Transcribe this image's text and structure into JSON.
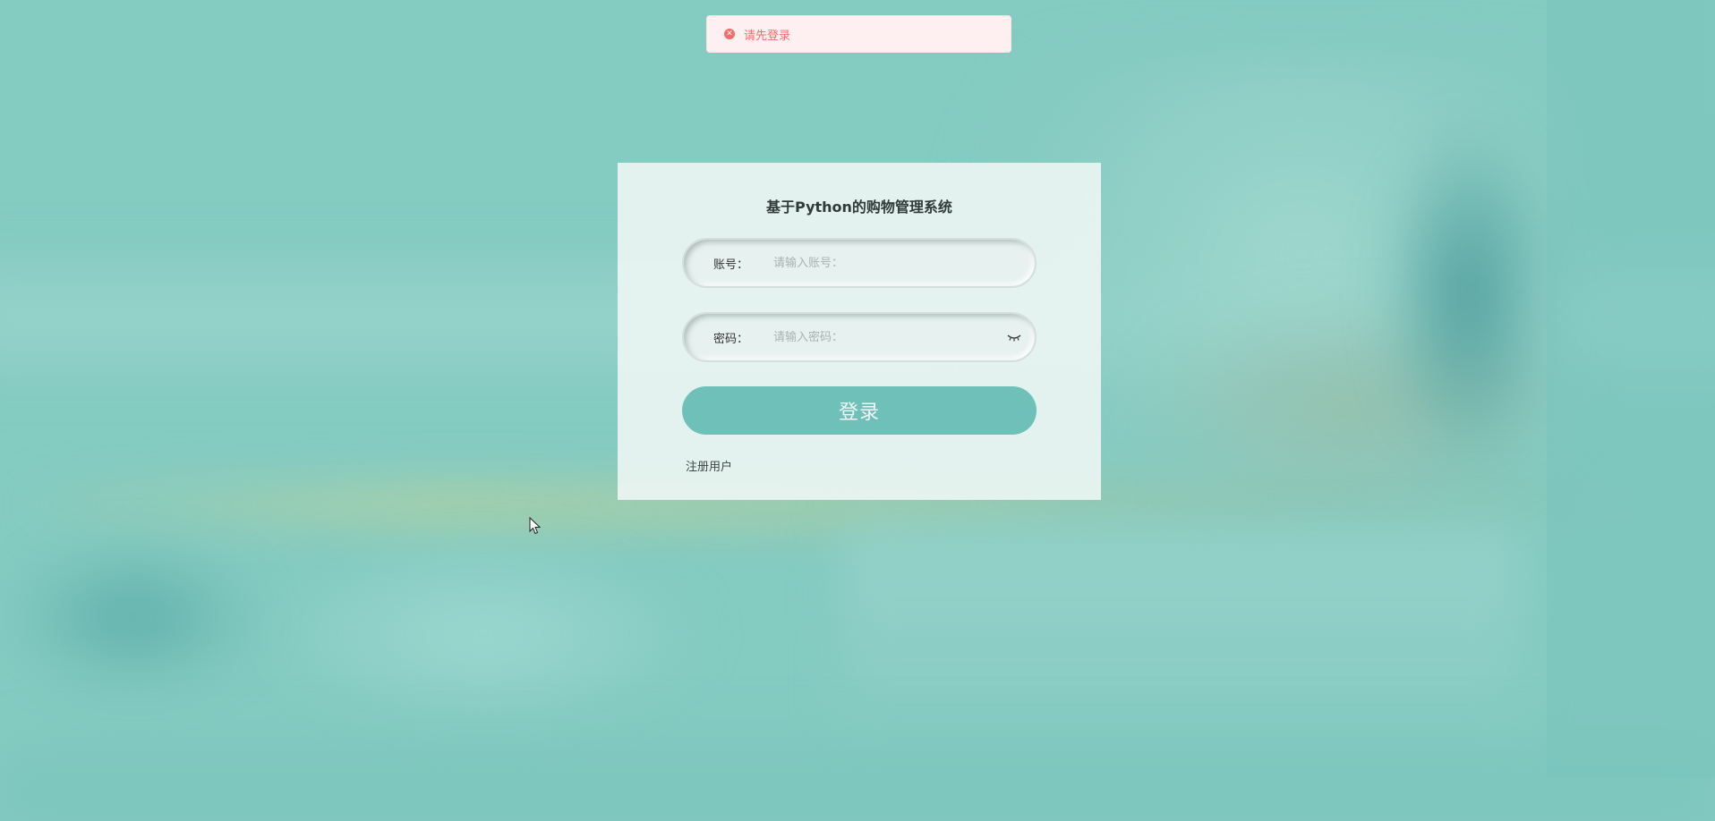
{
  "toast": {
    "icon": "error-circle-icon",
    "message": "请先登录",
    "color": "#f56c6c"
  },
  "login": {
    "title": "基于Python的购物管理系统",
    "username": {
      "label": "账号：",
      "placeholder": "请输入账号：",
      "value": ""
    },
    "password": {
      "label": "密码：",
      "placeholder": "请输入密码：",
      "value": "",
      "toggle_icon": "eye-closed-icon"
    },
    "submit_label": "登录",
    "register_label": "注册用户",
    "accent_color": "#6ec0b8"
  },
  "background": {
    "color": "#84cbc2"
  }
}
